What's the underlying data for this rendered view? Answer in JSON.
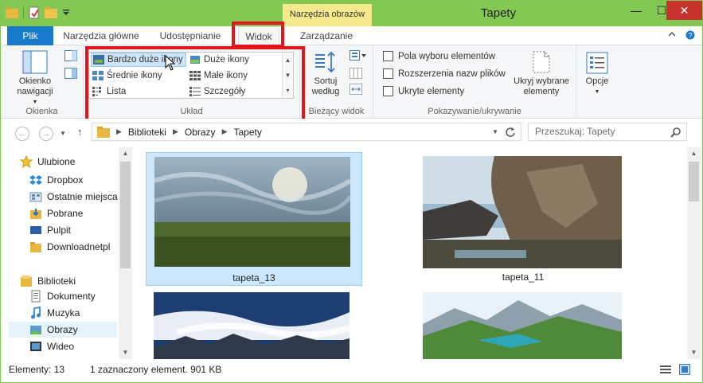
{
  "window": {
    "title": "Tapety",
    "contextual_tab_header": "Narzędzia obrazów",
    "minimize_glyph": "—",
    "maximize_glyph": "☐",
    "close_glyph": "✕"
  },
  "ribbon_tabs": {
    "file": "Plik",
    "home": "Narzędzia główne",
    "share": "Udostępnianie",
    "view": "Widok",
    "manage": "Zarządzanie"
  },
  "ribbon": {
    "panes_group": {
      "label": "Okienka",
      "nav_pane_button": [
        "Okienko",
        "nawigacji"
      ]
    },
    "layout_group": {
      "label": "Układ",
      "options": [
        {
          "label": "Bardzo duże ikony",
          "selected": true
        },
        {
          "label": "Duże ikony",
          "selected": false
        },
        {
          "label": "Średnie ikony",
          "selected": false
        },
        {
          "label": "Małe ikony",
          "selected": false
        },
        {
          "label": "Lista",
          "selected": false
        },
        {
          "label": "Szczegóły",
          "selected": false
        }
      ]
    },
    "current_view_group": {
      "label": "Bieżący widok",
      "sort_button": [
        "Sortuj",
        "według"
      ]
    },
    "show_hide_group": {
      "label": "Pokazywanie/ukrywanie",
      "checkboxes": [
        {
          "label": "Pola wyboru elementów",
          "checked": false
        },
        {
          "label": "Rozszerzenia nazw plików",
          "checked": false
        },
        {
          "label": "Ukryte elementy",
          "checked": false
        }
      ],
      "hide_selected_button": [
        "Ukryj wybrane",
        "elementy"
      ]
    },
    "options_button": "Opcje"
  },
  "address_bar": {
    "crumbs": [
      "Biblioteki",
      "Obrazy",
      "Tapety"
    ],
    "search_placeholder": "Przeszukaj: Tapety"
  },
  "nav_pane": {
    "items": [
      {
        "label": "Ulubione",
        "icon": "star-icon"
      },
      {
        "label": "Dropbox",
        "icon": "dropbox-icon"
      },
      {
        "label": "Ostatnie miejsca",
        "icon": "recent-places-icon"
      },
      {
        "label": "Pobrane",
        "icon": "downloads-folder-icon"
      },
      {
        "label": "Pulpit",
        "icon": "desktop-icon"
      },
      {
        "label": "Downloadnetpl",
        "icon": "folder-icon"
      },
      {
        "label": "Biblioteki",
        "icon": "libraries-icon"
      },
      {
        "label": "Dokumenty",
        "icon": "documents-icon"
      },
      {
        "label": "Muzyka",
        "icon": "music-icon"
      },
      {
        "label": "Obrazy",
        "icon": "pictures-icon",
        "selected": true
      },
      {
        "label": "Wideo",
        "icon": "video-icon"
      }
    ]
  },
  "files": [
    {
      "name": "tapeta_13",
      "selected": true
    },
    {
      "name": "tapeta_11",
      "selected": false
    }
  ],
  "status_bar": {
    "count": "Elementy: 13",
    "selection": "1 zaznaczony element. 901 KB"
  },
  "colors": {
    "accent": "#1979ca",
    "titlebar": "#83c853",
    "highlight_frame": "#e3161d"
  }
}
